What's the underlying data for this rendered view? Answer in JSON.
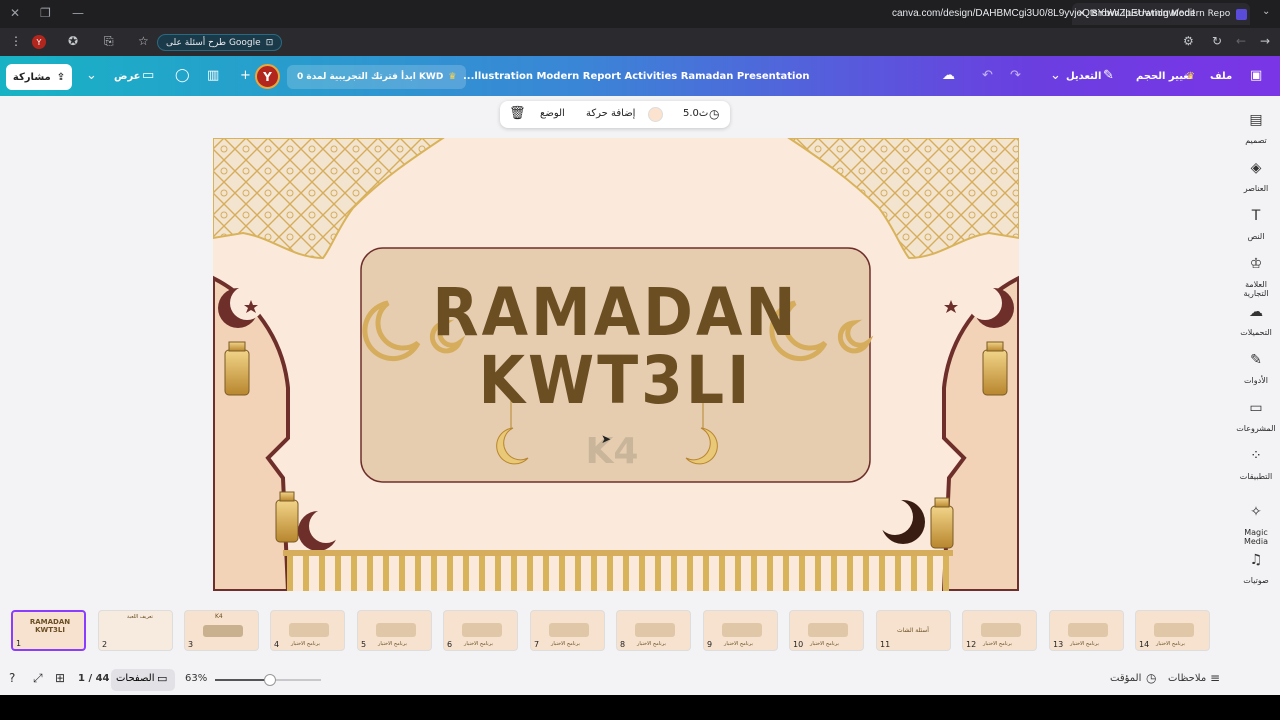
{
  "browser": {
    "tab_title": "Brown Ilustration Modern Repo",
    "url": "canva.com/design/DAHBMCgi3U0/8L9yvjeQtsYbWZpEUwmIgw/edit",
    "google_pill": "طرح أسئلة على Google",
    "profile_letter": "Y"
  },
  "topbar": {
    "file": "ملف",
    "resize": "تغيير الحجم",
    "edit": "التعديل",
    "doc_title": "...llustration Modern Report Activities Ramadan Presentation",
    "trial": "ابدأ فترتك التجريبية لمدة 0 KWD",
    "present": "عرض",
    "share": "مشاركة",
    "avatar": "Y"
  },
  "context_toolbar": {
    "duration": "5.0ث",
    "add_animation": "إضافة حركة",
    "position": "الوضع"
  },
  "sidebar": {
    "items": [
      {
        "label": "تصميم",
        "icon": "design-icon"
      },
      {
        "label": "العناصر",
        "icon": "elements-icon"
      },
      {
        "label": "النص",
        "icon": "text-icon"
      },
      {
        "label": "العلامة التجارية",
        "icon": "brand-icon"
      },
      {
        "label": "التحميلات",
        "icon": "upload-icon"
      },
      {
        "label": "الأدوات",
        "icon": "tools-icon"
      },
      {
        "label": "المشروعات",
        "icon": "folder-icon"
      },
      {
        "label": "التطبيقات",
        "icon": "apps-icon"
      },
      {
        "label": "Magic Media",
        "icon": "magic-media-icon"
      },
      {
        "label": "صوتيات",
        "icon": "audio-icon"
      }
    ]
  },
  "slide": {
    "title_line1": "RAMADAN",
    "title_line2": "KWT3LI",
    "logo": "K4",
    "colors": {
      "bg": "#fbe9dc",
      "panel": "#e6cdb0",
      "title": "#6b4e22",
      "frame": "#6e2f2a",
      "gold": "#d9b35a"
    }
  },
  "filmstrip": {
    "thumbs": [
      {
        "n": "1",
        "label": "RAMADAN KWT3LI"
      },
      {
        "n": "2",
        "label": "تعريف اللعبة"
      },
      {
        "n": "3",
        "label": "K4"
      },
      {
        "n": "4",
        "label": "برنامج الاختبار"
      },
      {
        "n": "5",
        "label": "برنامج الاختبار"
      },
      {
        "n": "6",
        "label": "برنامج الاختبار"
      },
      {
        "n": "7",
        "label": "برنامج الاختبار"
      },
      {
        "n": "8",
        "label": "برنامج الاختبار"
      },
      {
        "n": "9",
        "label": "برنامج الاختبار"
      },
      {
        "n": "10",
        "label": "برنامج الاختبار"
      },
      {
        "n": "11",
        "label": "أسئلة الشات"
      },
      {
        "n": "12",
        "label": "برنامج الاختبار"
      },
      {
        "n": "13",
        "label": "برنامج الاختبار"
      },
      {
        "n": "14",
        "label": "برنامج الاختبار"
      }
    ]
  },
  "bottombar": {
    "notes": "ملاحظات",
    "timer": "المؤقت",
    "zoom": "63%",
    "pages": "الصفحات",
    "page_count": "1 / 44"
  }
}
